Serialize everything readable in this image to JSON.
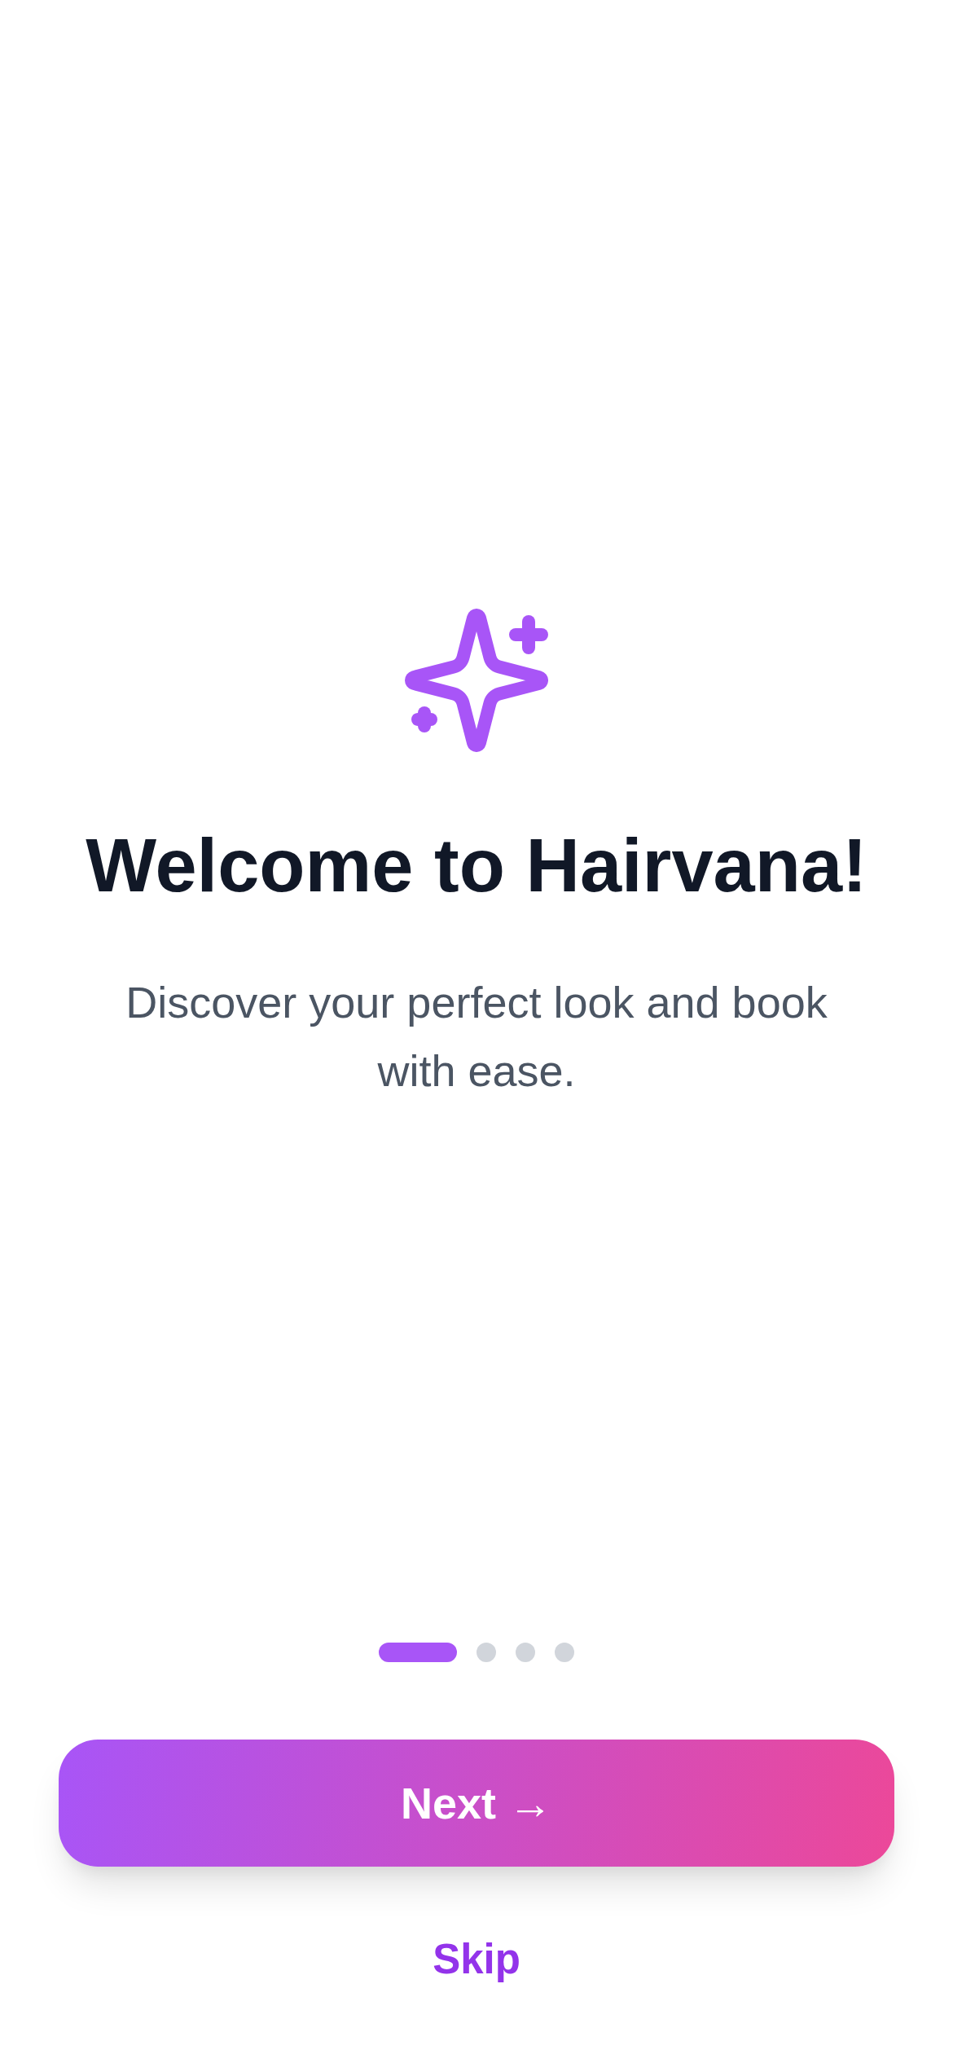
{
  "hero": {
    "title": "Welcome to Hairvana!",
    "subtitle": "Discover your perfect look and book with ease."
  },
  "pagination": [
    {
      "selected": true
    },
    {
      "selected": false
    },
    {
      "selected": false
    },
    {
      "selected": false
    }
  ],
  "next_button": {
    "label": "Next →"
  },
  "skip_button": {
    "label": "Skip"
  }
}
